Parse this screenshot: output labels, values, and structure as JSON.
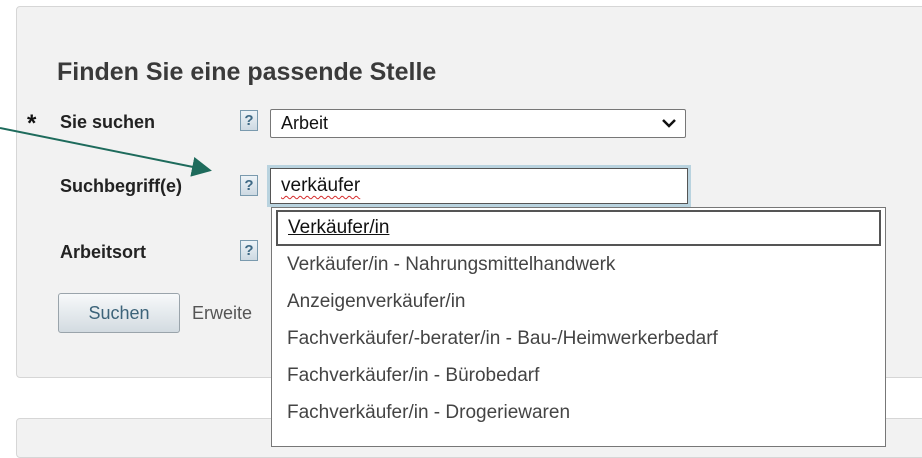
{
  "heading": "Finden Sie eine passende Stelle",
  "required_marker": "*",
  "fields": {
    "sie_suchen": {
      "label": "Sie suchen",
      "value": "Arbeit"
    },
    "suchbegriff": {
      "label": "Suchbegriff(e)",
      "value": "verkäufer"
    },
    "arbeitsort": {
      "label": "Arbeitsort"
    }
  },
  "help_glyph": "?",
  "buttons": {
    "search": "Suchen"
  },
  "links": {
    "advanced_partial": "Erweite"
  },
  "suggestions": [
    "Verkäufer/in",
    "Verkäufer/in - Nahrungsmittelhandwerk",
    "Anzeigenverkäufer/in",
    "Fachverkäufer/-berater/in - Bau-/Heimwerkerbedarf",
    "Fachverkäufer/in - Bürobedarf",
    "Fachverkäufer/in - Drogeriewaren"
  ],
  "colors": {
    "annotation_arrow": "#1e6b5c",
    "focus_ring": "#b9d3df"
  }
}
